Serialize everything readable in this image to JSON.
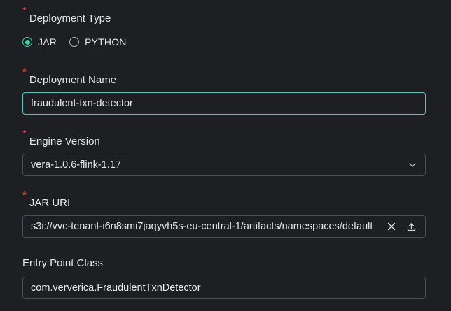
{
  "deployment_type": {
    "label": "Deployment Type",
    "required": true,
    "options": [
      {
        "label": "JAR",
        "checked": true
      },
      {
        "label": "PYTHON",
        "checked": false
      }
    ]
  },
  "deployment_name": {
    "label": "Deployment Name",
    "required": true,
    "value": "fraudulent-txn-detector"
  },
  "engine_version": {
    "label": "Engine Version",
    "required": true,
    "value": "vera-1.0.6-flink-1.17",
    "icon": "chevron-down-icon"
  },
  "jar_uri": {
    "label": "JAR URI",
    "required": true,
    "value": "s3i://vvc-tenant-i6n8smi7jaqyvh5s-eu-central-1/artifacts/namespaces/default",
    "icons": [
      "clear-icon",
      "upload-icon"
    ]
  },
  "entry_point_class": {
    "label": "Entry Point Class",
    "required": false,
    "value": "com.ververica.FraudulentTxnDetector"
  },
  "colors": {
    "background": "#1d1f22",
    "required_marker": "#e5484d",
    "accent": "#34d3a8",
    "focus_border": "#4ec9c0",
    "border": "#4a4d52"
  }
}
